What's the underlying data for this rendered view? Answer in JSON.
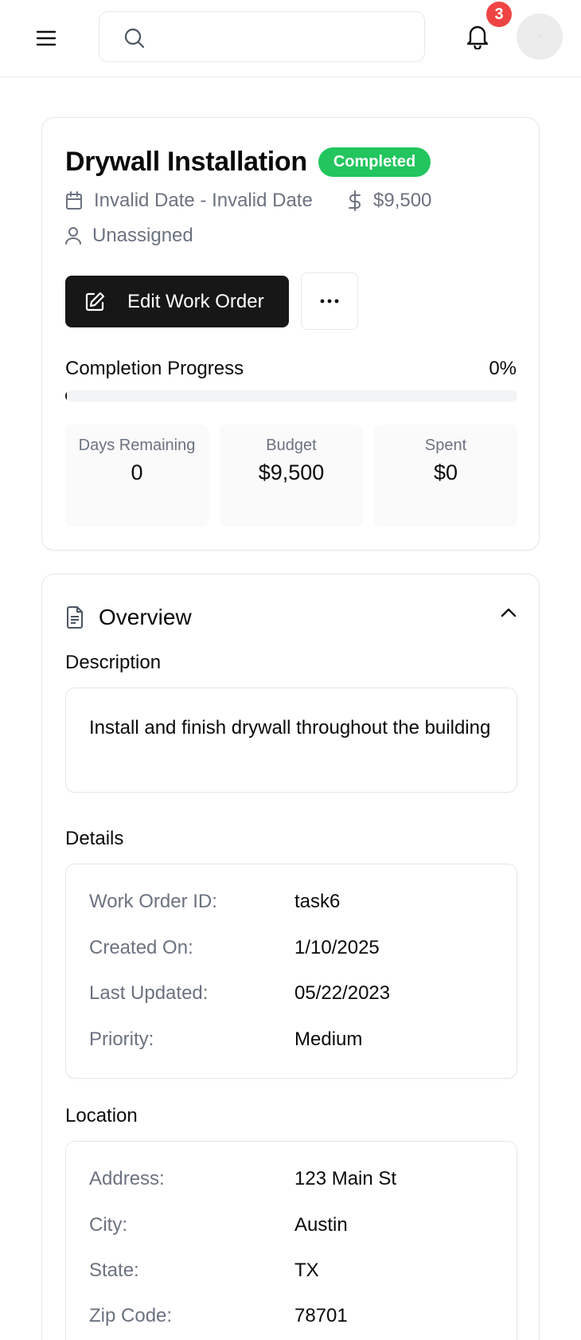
{
  "header": {
    "search_placeholder": "",
    "notification_count": "3"
  },
  "work_order": {
    "title": "Drywall Installation",
    "status": "Completed",
    "status_color": "#22c55e",
    "dates": "Invalid Date - Invalid Date",
    "budget_meta": "$9,500",
    "assignee": "Unassigned",
    "edit_label": "Edit Work Order",
    "progress_label": "Completion Progress",
    "progress_percent": "0%",
    "progress_value": 0,
    "stats": [
      {
        "label": "Days Remaining",
        "value": "0"
      },
      {
        "label": "Budget",
        "value": "$9,500"
      },
      {
        "label": "Spent",
        "value": "$0"
      }
    ]
  },
  "overview": {
    "title": "Overview",
    "description_label": "Description",
    "description": "Install and finish drywall throughout the building",
    "details_label": "Details",
    "details": [
      {
        "key": "Work Order ID:",
        "value": "task6"
      },
      {
        "key": "Created On:",
        "value": "1/10/2025"
      },
      {
        "key": "Last Updated:",
        "value": "05/22/2023"
      },
      {
        "key": "Priority:",
        "value": "Medium"
      }
    ],
    "location_label": "Location",
    "location": [
      {
        "key": "Address:",
        "value": "123 Main St"
      },
      {
        "key": "City:",
        "value": "Austin"
      },
      {
        "key": "State:",
        "value": "TX"
      },
      {
        "key": "Zip Code:",
        "value": "78701"
      }
    ]
  }
}
